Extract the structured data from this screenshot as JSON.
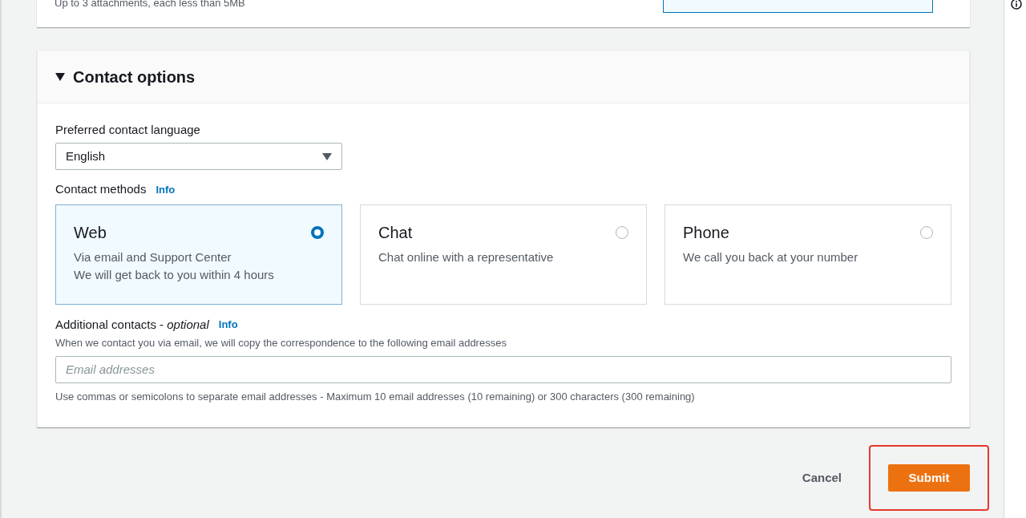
{
  "attachments": {
    "hint": "Up to 3 attachments, each less than 5MB"
  },
  "contact_options": {
    "title": "Contact options",
    "expanded": true,
    "language": {
      "label": "Preferred contact language",
      "value": "English"
    },
    "methods": {
      "label": "Contact methods",
      "info": "Info",
      "options": [
        {
          "title": "Web",
          "lines": [
            "Via email and Support Center",
            "We will get back to you within 4 hours"
          ],
          "selected": true
        },
        {
          "title": "Chat",
          "lines": [
            "Chat online with a representative"
          ],
          "selected": false
        },
        {
          "title": "Phone",
          "lines": [
            "We call you back at your number"
          ],
          "selected": false
        }
      ]
    },
    "additional_contacts": {
      "label": "Additional contacts - *optional*",
      "info": "Info",
      "description": "When we contact you via email, we will copy the correspondence to the following email addresses",
      "placeholder": "Email addresses",
      "constraint": "Use commas or semicolons to separate email addresses - Maximum 10 email addresses (10 remaining) or 300 characters (300 remaining)"
    }
  },
  "actions": [
    {
      "label": "Cancel",
      "kind": "link"
    },
    {
      "label": "Submit",
      "kind": "primary",
      "highlighted": true
    }
  ]
}
